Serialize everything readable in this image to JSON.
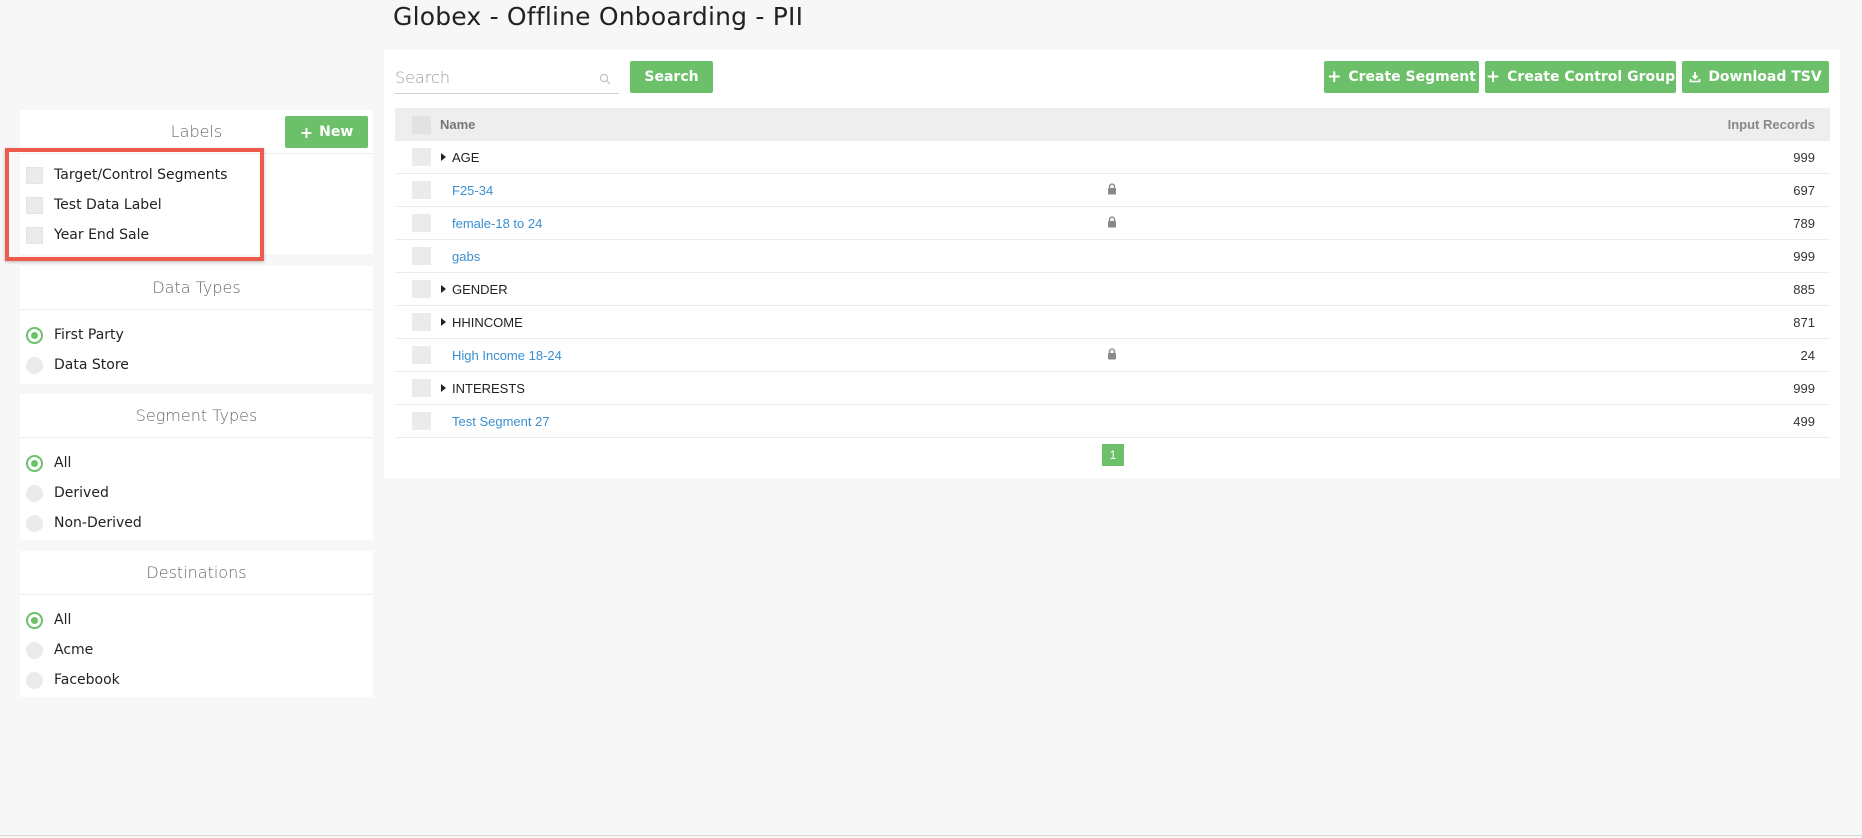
{
  "page": {
    "title": "Globex - Offline Onboarding - PII"
  },
  "labels": {
    "header": "Labels",
    "new_button": "New",
    "items": [
      "Target/Control Segments",
      "Test Data Label",
      "Year End Sale"
    ]
  },
  "data_types": {
    "header": "Data Types",
    "options": [
      {
        "label": "First Party",
        "selected": true
      },
      {
        "label": "Data Store",
        "selected": false
      }
    ]
  },
  "segment_types": {
    "header": "Segment Types",
    "options": [
      {
        "label": "All",
        "selected": true
      },
      {
        "label": "Derived",
        "selected": false
      },
      {
        "label": "Non-Derived",
        "selected": false
      }
    ]
  },
  "destinations": {
    "header": "Destinations",
    "options": [
      {
        "label": "All",
        "selected": true
      },
      {
        "label": "Acme",
        "selected": false
      },
      {
        "label": "Facebook",
        "selected": false
      }
    ]
  },
  "toolbar": {
    "search_placeholder": "Search",
    "search_button": "Search",
    "create_segment": "Create Segment",
    "create_control_group": "Create Control Group",
    "download_tsv": "Download TSV"
  },
  "table": {
    "headers": {
      "name": "Name",
      "records": "Input Records"
    },
    "rows": [
      {
        "name": "AGE",
        "type": "folder",
        "locked": false,
        "records": "999"
      },
      {
        "name": "F25-34",
        "type": "link",
        "locked": true,
        "records": "697"
      },
      {
        "name": "female-18 to 24",
        "type": "link",
        "locked": true,
        "records": "789"
      },
      {
        "name": "gabs",
        "type": "link",
        "locked": false,
        "records": "999"
      },
      {
        "name": "GENDER",
        "type": "folder",
        "locked": false,
        "records": "885"
      },
      {
        "name": "HHINCOME",
        "type": "folder",
        "locked": false,
        "records": "871"
      },
      {
        "name": "High Income 18-24",
        "type": "link",
        "locked": true,
        "records": "24"
      },
      {
        "name": "INTERESTS",
        "type": "folder",
        "locked": false,
        "records": "999"
      },
      {
        "name": "Test Segment 27",
        "type": "link",
        "locked": false,
        "records": "499"
      }
    ]
  },
  "pagination": {
    "current": "1"
  },
  "colors": {
    "accent": "#6cc06a",
    "link": "#3a8fd1",
    "highlight": "#ec5b4d"
  }
}
